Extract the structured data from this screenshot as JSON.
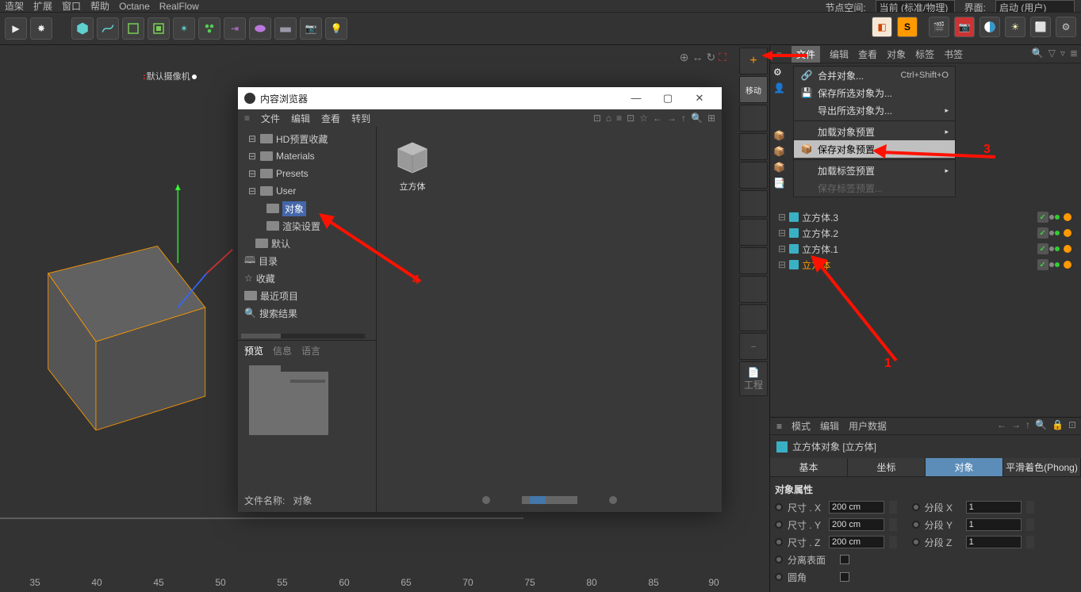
{
  "top_menu": {
    "m1": "造架",
    "m2": "扩展",
    "m3": "窗口",
    "m4": "帮助",
    "m5": "Octane",
    "m6": "RealFlow"
  },
  "top_right": {
    "label1": "节点空间:",
    "val1": "当前 (标准/物理)",
    "label2": "界面:",
    "val2": "启动 (用户)"
  },
  "viewport": {
    "camera": "默认摄像机"
  },
  "side_tool": {
    "move": "移动",
    "project": "工程"
  },
  "obj_menu": {
    "file": "文件",
    "edit": "编辑",
    "view": "查看",
    "object": "对象",
    "tag": "标签",
    "bookmark": "书签"
  },
  "ctx": {
    "merge": "合并对象...",
    "merge_sc": "Ctrl+Shift+O",
    "save_sel": "保存所选对象为...",
    "export_sel": "导出所选对象为...",
    "load_preset": "加载对象预置",
    "save_preset": "保存对象预置...",
    "load_tag": "加载标签预置",
    "save_tag": "保存标签预置..."
  },
  "objects": {
    "o0": "立方体.3",
    "o1": "立方体.2",
    "o2": "立方体.1",
    "o3": "立方体"
  },
  "attr_menu": {
    "mode": "模式",
    "edit": "编辑",
    "ud": "用户数据"
  },
  "attr_title": "立方体对象 [立方体]",
  "attr_tabs": {
    "basic": "基本",
    "coord": "坐标",
    "obj": "对象",
    "phong": "平滑着色(Phong)"
  },
  "props": {
    "header": "对象属性",
    "sx": "尺寸 . X",
    "sy": "尺寸 . Y",
    "sz": "尺寸 . Z",
    "vx": "200 cm",
    "vy": "200 cm",
    "vz": "200 cm",
    "seg": "分段 X",
    "segy": "分段 Y",
    "segz": "分段 Z",
    "segv": "1",
    "sep": "分离表面",
    "round": "圆角"
  },
  "dlg": {
    "title": "内容浏览器",
    "menu": {
      "file": "文件",
      "edit": "编辑",
      "view": "查看",
      "goto": "转到"
    },
    "tree": {
      "hd": "HD预置收藏",
      "mat": "Materials",
      "pre": "Presets",
      "user": "User",
      "obj": "对象",
      "render": "渲染设置",
      "def": "默认",
      "cat": "目录",
      "fav": "收藏",
      "recent": "最近项目",
      "search": "搜索结果"
    },
    "tabs": {
      "preview": "预览",
      "info": "信息",
      "lang": "语言"
    },
    "fn_label": "文件名称:",
    "fn_val": "对象",
    "thumb_cap": "立方体"
  },
  "anno": {
    "n1": "1",
    "n3": "3",
    "n4": "4"
  },
  "ruler": {
    "v35": "35",
    "v40": "40",
    "v45": "45",
    "v50": "50",
    "v55": "55",
    "v60": "60",
    "v65": "65",
    "v70": "70",
    "v75": "75",
    "v80": "80",
    "v85": "85",
    "v90": "90"
  }
}
